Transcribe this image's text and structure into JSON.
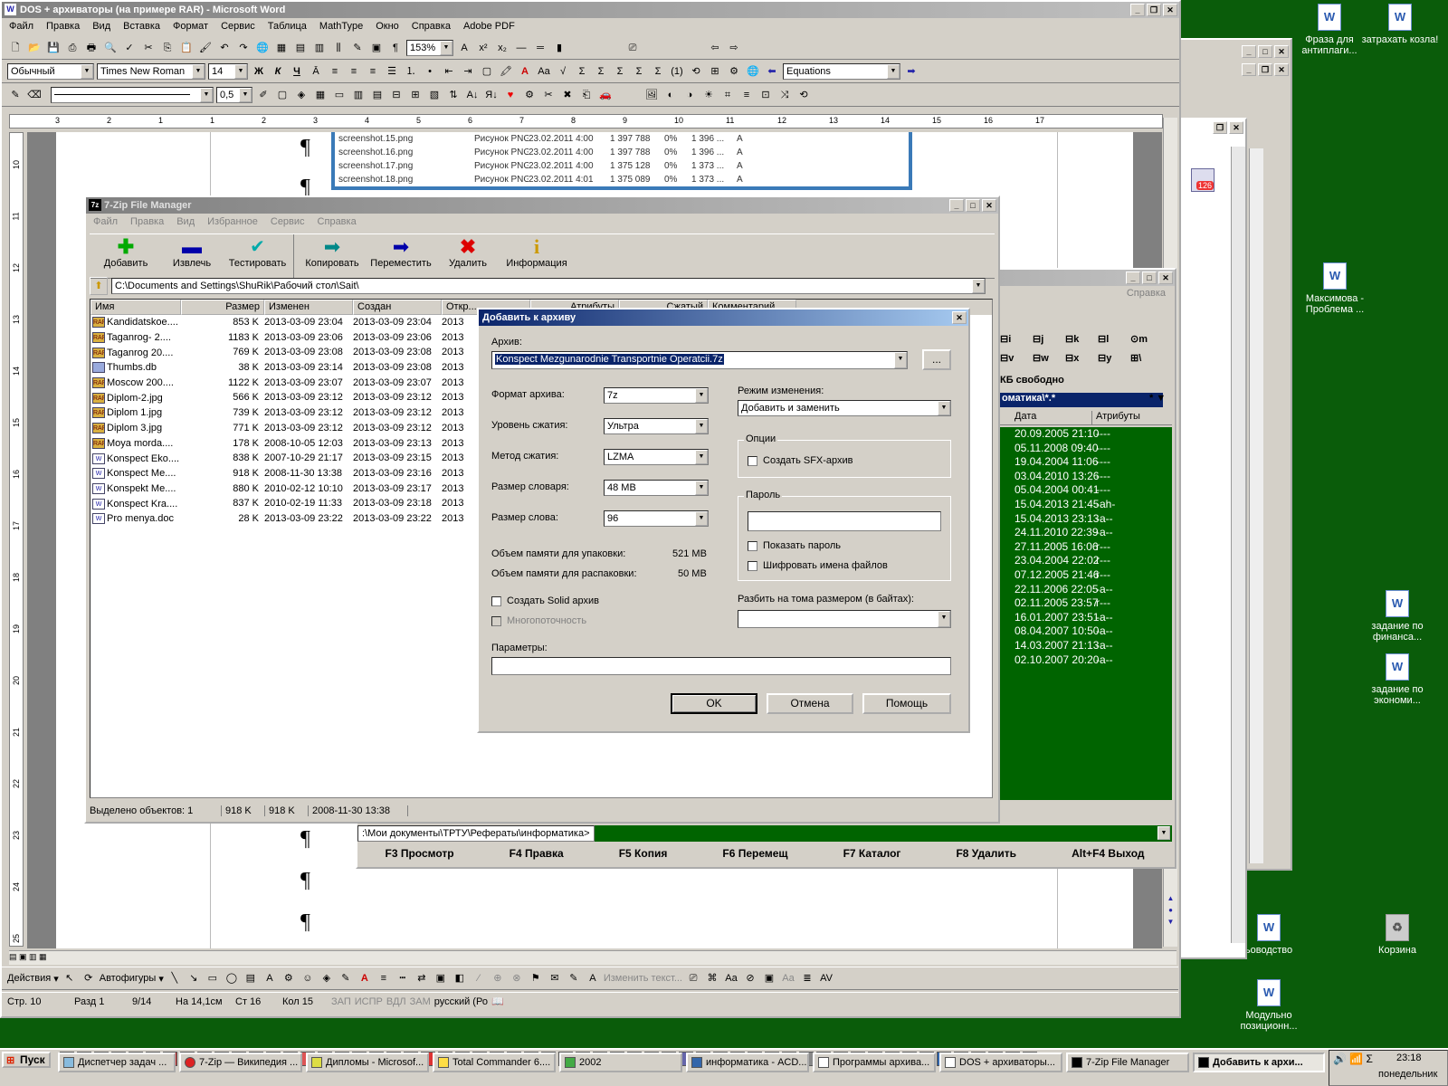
{
  "word": {
    "title": "DOS + архиваторы (на примере RAR) - Microsoft Word",
    "menu": [
      "Файл",
      "Правка",
      "Вид",
      "Вставка",
      "Формат",
      "Сервис",
      "Таблица",
      "MathType",
      "Окно",
      "Справка",
      "Adobe PDF"
    ],
    "zoom": "153%",
    "style": "Обычный",
    "font": "Times New Roman",
    "font_size": "14",
    "equations": "Equations",
    "line_width": "0,5",
    "ruler": [
      "3",
      "2",
      "1",
      "1",
      "2",
      "3",
      "4",
      "5",
      "6",
      "7",
      "8",
      "9",
      "10",
      "11",
      "12",
      "13",
      "14",
      "15",
      "16",
      "17"
    ],
    "vruler": [
      "10",
      "11",
      "12",
      "13",
      "14",
      "15",
      "16",
      "17",
      "18",
      "19",
      "20",
      "21",
      "22",
      "23",
      "24",
      "25"
    ],
    "embedded_rows": [
      {
        "name": "screenshot.15.png",
        "type": "Рисунок PNG",
        "date": "23.02.2011 4:00",
        "size": "1 397 788",
        "pct": "0%",
        "packed": "1 396 ...",
        "attr": "A"
      },
      {
        "name": "screenshot.16.png",
        "type": "Рисунок PNG",
        "date": "23.02.2011 4:00",
        "size": "1 397 788",
        "pct": "0%",
        "packed": "1 396 ...",
        "attr": "A"
      },
      {
        "name": "screenshot.17.png",
        "type": "Рисунок PNG",
        "date": "23.02.2011 4:00",
        "size": "1 375 128",
        "pct": "0%",
        "packed": "1 373 ...",
        "attr": "A"
      },
      {
        "name": "screenshot.18.png",
        "type": "Рисунок PNG",
        "date": "23.02.2011 4:01",
        "size": "1 375 089",
        "pct": "0%",
        "packed": "1 373 ...",
        "attr": "A"
      }
    ],
    "draw_actions": "Действия",
    "draw_autoshapes": "Автофигуры",
    "draw_edit_text": "Изменить текст...",
    "status": {
      "page": "Стр.  10",
      "section": "Разд  1",
      "pages": "9/14",
      "at": "На  14,1см",
      "line": "Ст  16",
      "col": "Кол  15",
      "rec": "ЗАП",
      "trk": "ИСПР",
      "ext": "ВДЛ",
      "ovr": "ЗАМ",
      "lang": "русский (Ро"
    }
  },
  "sevenzip": {
    "title": "7-Zip File Manager",
    "menu": [
      "Файл",
      "Правка",
      "Вид",
      "Избранное",
      "Сервис",
      "Справка"
    ],
    "toolbar": [
      "Добавить",
      "Извлечь",
      "Тестировать",
      "Копировать",
      "Переместить",
      "Удалить",
      "Информация"
    ],
    "path": "C:\\Documents and Settings\\ShuRik\\Рабочий стол\\Sait\\",
    "columns": [
      "Имя",
      "Размер",
      "Изменен",
      "Создан",
      "Откр...",
      "Атрибуты",
      "Сжатый",
      "Комментарий"
    ],
    "files": [
      {
        "icon": "rar",
        "name": "Kandidatskoe....",
        "size": "853 K",
        "modified": "2013-03-09 23:04",
        "created": "2013-03-09 23:04",
        "opened": "2013"
      },
      {
        "icon": "rar",
        "name": "Taganrog- 2....",
        "size": "1183 K",
        "modified": "2013-03-09 23:06",
        "created": "2013-03-09 23:06",
        "opened": "2013"
      },
      {
        "icon": "rar",
        "name": "Taganrog 20....",
        "size": "769 K",
        "modified": "2013-03-09 23:08",
        "created": "2013-03-09 23:08",
        "opened": "2013"
      },
      {
        "icon": "db",
        "name": "Thumbs.db",
        "size": "38 K",
        "modified": "2013-03-09 23:14",
        "created": "2013-03-09 23:08",
        "opened": "2013"
      },
      {
        "icon": "rar",
        "name": "Moscow 200....",
        "size": "1122 K",
        "modified": "2013-03-09 23:07",
        "created": "2013-03-09 23:07",
        "opened": "2013"
      },
      {
        "icon": "rar",
        "name": "Diplom-2.jpg",
        "size": "566 K",
        "modified": "2013-03-09 23:12",
        "created": "2013-03-09 23:12",
        "opened": "2013"
      },
      {
        "icon": "rar",
        "name": "Diplom 1.jpg",
        "size": "739 K",
        "modified": "2013-03-09 23:12",
        "created": "2013-03-09 23:12",
        "opened": "2013"
      },
      {
        "icon": "rar",
        "name": "Diplom 3.jpg",
        "size": "771 K",
        "modified": "2013-03-09 23:12",
        "created": "2013-03-09 23:12",
        "opened": "2013"
      },
      {
        "icon": "rar",
        "name": "Moya morda....",
        "size": "178 K",
        "modified": "2008-10-05 12:03",
        "created": "2013-03-09 23:13",
        "opened": "2013"
      },
      {
        "icon": "doc",
        "name": "Konspect Eko....",
        "size": "838 K",
        "modified": "2007-10-29 21:17",
        "created": "2013-03-09 23:15",
        "opened": "2013"
      },
      {
        "icon": "doc",
        "name": "Konspect Me....",
        "size": "918 K",
        "modified": "2008-11-30 13:38",
        "created": "2013-03-09 23:16",
        "opened": "2013"
      },
      {
        "icon": "doc",
        "name": "Konspekt Me....",
        "size": "880 K",
        "modified": "2010-02-12 10:10",
        "created": "2013-03-09 23:17",
        "opened": "2013"
      },
      {
        "icon": "doc",
        "name": "Konspect Kra....",
        "size": "837 K",
        "modified": "2010-02-19 11:33",
        "created": "2013-03-09 23:18",
        "opened": "2013"
      },
      {
        "icon": "doc",
        "name": "Pro menya.doc",
        "size": "28 K",
        "modified": "2013-03-09 23:22",
        "created": "2013-03-09 23:22",
        "opened": "2013"
      }
    ],
    "status": {
      "selected": "Выделено объектов: 1",
      "size1": "918 K",
      "size2": "918 K",
      "date": "2008-11-30 13:38"
    }
  },
  "dialog": {
    "title": "Добавить к архиву",
    "archive_label": "Архив:",
    "archive_value": "Konspect Mezgunarodnie Transportnie Operatcii.7z",
    "browse": "...",
    "format_label": "Формат архива:",
    "format_value": "7z",
    "level_label": "Уровень сжатия:",
    "level_value": "Ультра",
    "method_label": "Метод сжатия:",
    "method_value": "LZMA",
    "dict_label": "Размер словаря:",
    "dict_value": "48 MB",
    "word_label": "Размер слова:",
    "word_value": "96",
    "mem_pack_label": "Объем памяти для упаковки:",
    "mem_pack_value": "521 MB",
    "mem_unpack_label": "Объем памяти для распаковки:",
    "mem_unpack_value": "50 MB",
    "solid": "Создать Solid архив",
    "multithread": "Многопоточность",
    "params_label": "Параметры:",
    "update_label": "Режим изменения:",
    "update_value": "Добавить и заменить",
    "options_label": "Опции",
    "sfx": "Создать SFX-архив",
    "password_label": "Пароль",
    "show_password": "Показать пароль",
    "encrypt_names": "Шифровать имена файлов",
    "split_label": "Разбить на тома размером (в байтах):",
    "ok": "OK",
    "cancel": "Отмена",
    "help": "Помощь"
  },
  "tc": {
    "menu_right": "Справка",
    "drives": [
      "i",
      "j",
      "k",
      "l",
      "m",
      "v",
      "w",
      "x",
      "y",
      "\\"
    ],
    "free": "КБ свободно",
    "path_tail": "оматика\\*.*",
    "col_date": "Дата",
    "col_attr": "Атрибуты",
    "rows": [
      {
        "date": "20.09.2005 21:10",
        "attr": "----"
      },
      {
        "date": "05.11.2008 09:40",
        "attr": "----"
      },
      {
        "date": "19.04.2004 11:06",
        "attr": "----"
      },
      {
        "date": "03.04.2010 13:26",
        "attr": "----"
      },
      {
        "date": "05.04.2004 00:41",
        "attr": "----"
      },
      {
        "date": "15.04.2013 21:45",
        "attr": "-ah-"
      },
      {
        "date": "15.04.2013 23:13",
        "attr": "-a--"
      },
      {
        "date": "24.11.2010 22:39",
        "attr": "-a--"
      },
      {
        "date": "27.11.2005 16:06",
        "attr": "r---"
      },
      {
        "date": "23.04.2004 22:02",
        "attr": "r---"
      },
      {
        "date": "07.12.2005 21:46",
        "attr": "r---"
      },
      {
        "date": "22.11.2006 22:05",
        "attr": "-a--"
      },
      {
        "date": "02.11.2005 23:57",
        "attr": "r---"
      },
      {
        "date": "16.01.2007 23:51",
        "attr": "-a--"
      },
      {
        "date": "08.04.2007 10:50",
        "attr": "-a--"
      },
      {
        "date": "14.03.2007 21:13",
        "attr": "-a--"
      },
      {
        "date": "02.10.2007 20:20",
        "attr": "-a--"
      }
    ],
    "cmdline": ":\\Мои документы\\ТРТУ\\Рефераты\\информатика>",
    "fkeys": [
      "F3 Просмотр",
      "F4 Правка",
      "F5 Копия",
      "F6 Перемещ",
      "F7 Каталог",
      "F8 Удалить",
      "Alt+F4 Выход"
    ]
  },
  "desktop": [
    {
      "label": "Фраза для антиплаги..."
    },
    {
      "label": "затрахать козла!"
    },
    {
      "label": "Максимова - Проблема ..."
    },
    {
      "label": "задание по финанса..."
    },
    {
      "label": "задание по экономи..."
    },
    {
      "label": "ьоводство"
    },
    {
      "label": "Корзина"
    },
    {
      "label": "Модульно позиционн..."
    }
  ],
  "taskbar": {
    "start": "Пуск",
    "tasks": [
      "Диспетчер задач ...",
      "7-Zip — Википедия ...",
      "Дипломы - Microsof...",
      "Total Commander 6....",
      "2002",
      "информатика - ACD...",
      "Программы архива...",
      "DOS + архиваторы...",
      "7-Zip File Manager",
      "Добавить к архи..."
    ],
    "time": "23:18",
    "day": "понедельник",
    "badge": "126"
  }
}
